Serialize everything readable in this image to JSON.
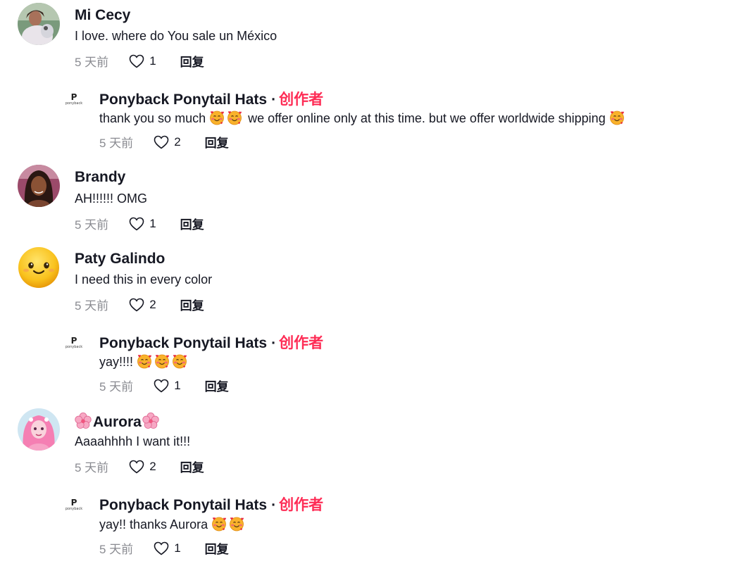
{
  "labels": {
    "creator_badge": "创作者",
    "reply": "回复",
    "separator": "·"
  },
  "comments": [
    {
      "user": "Mi Cecy",
      "text": "I love. where do You sale un México",
      "time": "5 天前",
      "likes": "1"
    },
    {
      "user": "Ponyback Ponytail Hats",
      "text_before": "thank you so much ",
      "text_after": " we offer online only at this time. but we offer worldwide shipping ",
      "time": "5 天前",
      "likes": "2",
      "logo_text": "ponyback"
    },
    {
      "user": "Brandy",
      "text": "AH!!!!!! OMG",
      "time": "5 天前",
      "likes": "1"
    },
    {
      "user": "Paty Galindo",
      "text": "I need this in every color",
      "time": "5 天前",
      "likes": "2"
    },
    {
      "user": "Ponyback Ponytail Hats",
      "text": "yay!!!! ",
      "time": "5 天前",
      "likes": "1",
      "logo_text": "ponyback"
    },
    {
      "user": "Aurora",
      "text": "Aaaahhhh I want it!!!",
      "time": "5 天前",
      "likes": "2"
    },
    {
      "user": "Ponyback Ponytail Hats",
      "text": "yay!! thanks Aurora ",
      "time": "5 天前",
      "likes": "1",
      "logo_text": "ponyback"
    }
  ],
  "colors": {
    "creator": "#fe2c55",
    "meta": "#8a8b91",
    "text": "#161823"
  },
  "icons": [
    "heart-outline-icon",
    "smiling-face-with-hearts-emoji",
    "cherry-blossom-emoji",
    "slightly-smiling-face-emoji"
  ]
}
